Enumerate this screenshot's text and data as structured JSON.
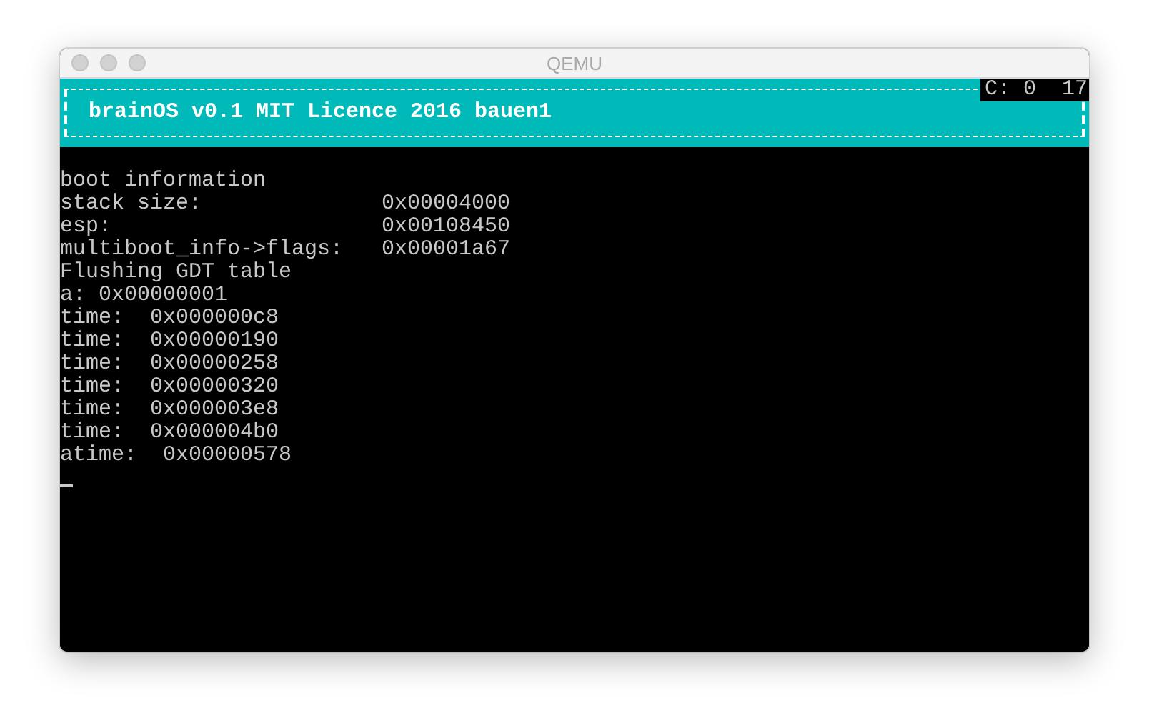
{
  "window": {
    "title": "QEMU"
  },
  "header": {
    "title": "brainOS v0.1 MIT Licence 2016 bauen1",
    "status": "C: 0  17"
  },
  "console_lines": [
    "boot information",
    "stack size:              0x00004000",
    "esp:                     0x00108450",
    "multiboot_info->flags:   0x00001a67",
    "Flushing GDT table",
    "a: 0x00000001",
    "time:  0x000000c8",
    "time:  0x00000190",
    "time:  0x00000258",
    "time:  0x00000320",
    "time:  0x000003e8",
    "time:  0x000004b0",
    "atime:  0x00000578"
  ],
  "cursor": {
    "visible": true
  }
}
